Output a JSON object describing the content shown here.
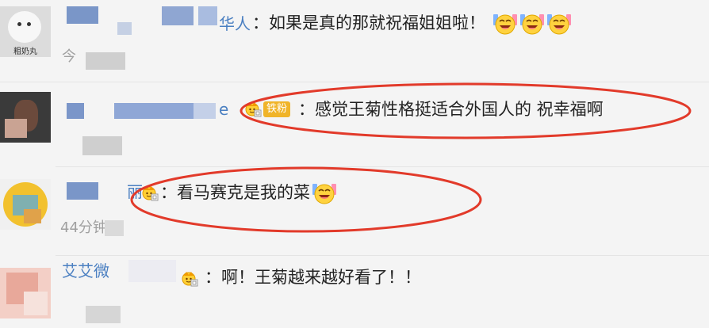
{
  "comments": [
    {
      "name_tail": "华人",
      "text": "：如果是真的那就祝福姐姐啦！",
      "avatar_caption": "粗奶丸",
      "time": "今",
      "emoji_count": 3
    },
    {
      "name_tail": "e",
      "tag": "铁粉",
      "text": "：感觉王菊性格挺适合外国人的 祝幸福啊"
    },
    {
      "name_tail": "丽",
      "text": "：看马赛克是我的菜",
      "time": "44分钟",
      "emoji_count": 1
    },
    {
      "name_tail": "艾艾微",
      "text": "：啊！王菊越来越好看了！！"
    }
  ],
  "colors": {
    "highlight_circle": "#e23a2a",
    "name": "#4a7fc1",
    "fan_tag": "#f0b429"
  }
}
